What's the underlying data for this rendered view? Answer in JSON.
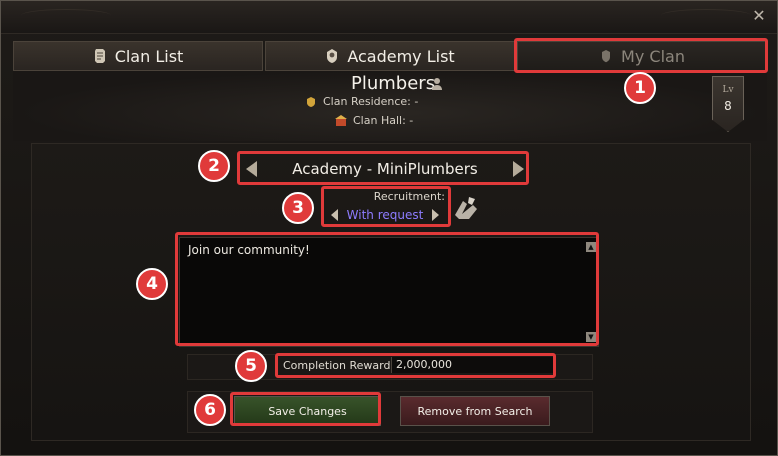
{
  "tabs": [
    {
      "label": "Clan List",
      "icon": "scroll-icon",
      "active": false
    },
    {
      "label": "Academy List",
      "icon": "crest-icon",
      "active": false
    },
    {
      "label": "My Clan",
      "icon": "shield-icon",
      "active": true
    }
  ],
  "clan": {
    "name": "Plumbers",
    "residence": "Clan Residence: -",
    "hall": "Clan Hall: -",
    "level_label": "Lv",
    "level": "8"
  },
  "academy": {
    "name": "Academy - MiniPlumbers",
    "recruitment_label": "Recruitment:",
    "recruitment_value": "With request",
    "description": "Join our community!",
    "reward_label": "Completion Reward:",
    "reward_value": "2,000,000"
  },
  "buttons": {
    "save": "Save Changes",
    "remove": "Remove from Search"
  },
  "annotations": [
    "1",
    "2",
    "3",
    "4",
    "5",
    "6"
  ],
  "colors": {
    "highlight": "#e03a3a",
    "recruitment_value": "#8e7cff",
    "save_button": "#2f4a22",
    "remove_button": "#4a2326"
  }
}
